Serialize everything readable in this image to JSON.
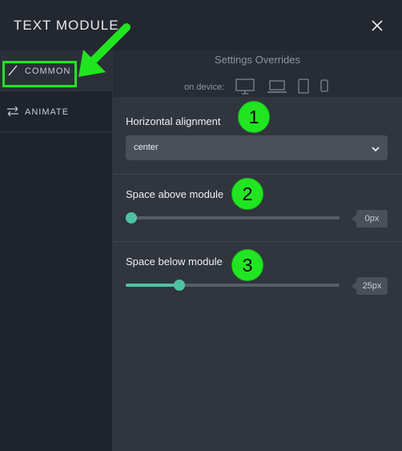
{
  "header": {
    "title": "TEXT MODULE",
    "close_icon": "close-icon"
  },
  "sidebar": {
    "items": [
      {
        "label": "COMMON",
        "icon": "check-icon",
        "active": true
      },
      {
        "label": "ANIMATE",
        "icon": "swap-arrows-icon",
        "active": false
      }
    ]
  },
  "overrides": {
    "title": "Settings Overrides",
    "device_label": "on device:",
    "devices": [
      "desktop-icon",
      "laptop-icon",
      "tablet-icon",
      "phone-icon"
    ]
  },
  "settings": {
    "alignment": {
      "label": "Horizontal alignment",
      "value": "center"
    },
    "space_above": {
      "label": "Space above module",
      "value": "0px",
      "level": 0
    },
    "space_below": {
      "label": "Space below module",
      "value": "25px",
      "level": 0.25
    }
  },
  "annotations": {
    "badges": [
      "1",
      "2",
      "3"
    ],
    "accent": "#21e521"
  },
  "colors": {
    "slider": "#4fc3a1",
    "background": "#23272f"
  }
}
